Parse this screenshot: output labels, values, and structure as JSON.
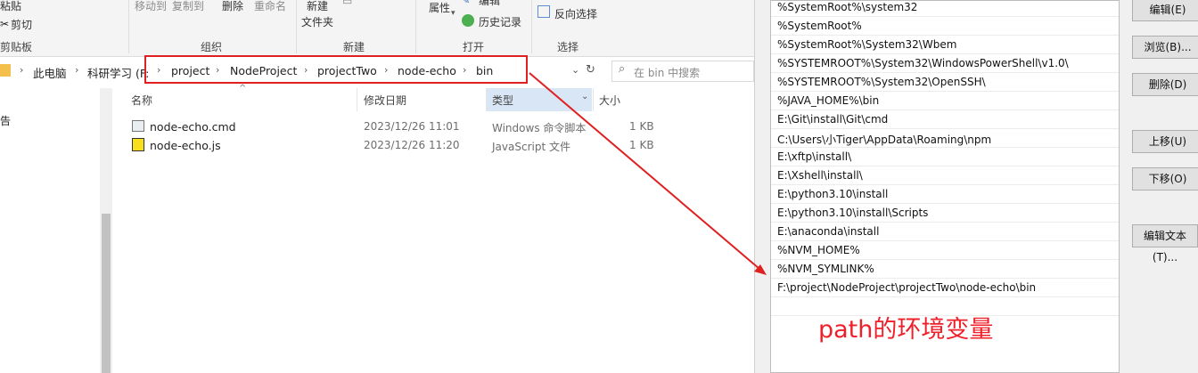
{
  "ribbon": {
    "paste": "粘贴",
    "cut": "剪切",
    "clipboard": "剪贴板",
    "move_to": "移动到",
    "copy_to": "复制到",
    "delete": "删除",
    "rename": "重命名",
    "organize": "组织",
    "new_folder_1": "新建",
    "new_folder_2": "文件夹",
    "new_group": "新建",
    "properties": "属性",
    "edit": "编辑",
    "history": "历史记录",
    "open_group": "打开",
    "invert_select": "反向选择",
    "select_group": "选择"
  },
  "address": {
    "this_pc": "此电脑",
    "drive": "科研学习 (F:",
    "path": [
      "project",
      "NodeProject",
      "projectTwo",
      "node-echo",
      "bin"
    ],
    "search_placeholder": "在 bin 中搜索"
  },
  "file_list": {
    "headers": {
      "name": "名称",
      "modified": "修改日期",
      "type": "类型",
      "size": "大小"
    },
    "files": [
      {
        "name": "node-echo.cmd",
        "modified": "2023/12/26 11:01",
        "type": "Windows 命令脚本",
        "size": "1 KB",
        "icon": "cmd-file-icon"
      },
      {
        "name": "node-echo.js",
        "modified": "2023/12/26 11:20",
        "type": "JavaScript 文件",
        "size": "1 KB",
        "icon": "js-file-icon"
      }
    ],
    "left_pane_partial": "告"
  },
  "env_editor": {
    "paths": [
      "%SystemRoot%\\system32",
      "%SystemRoot%",
      "%SystemRoot%\\System32\\Wbem",
      "%SYSTEMROOT%\\System32\\WindowsPowerShell\\v1.0\\",
      "%SYSTEMROOT%\\System32\\OpenSSH\\",
      "%JAVA_HOME%\\bin",
      "E:\\Git\\install\\Git\\cmd",
      "C:\\Users\\小Tiger\\AppData\\Roaming\\npm",
      "E:\\xftp\\install\\",
      "E:\\Xshell\\install\\",
      "E:\\python3.10\\install",
      "E:\\python3.10\\install\\Scripts",
      "E:\\anaconda\\install",
      "%NVM_HOME%",
      "%NVM_SYMLINK%",
      "F:\\project\\NodeProject\\projectTwo\\node-echo\\bin"
    ],
    "buttons": {
      "edit": "编辑(E)",
      "browse": "浏览(B)...",
      "delete": "删除(D)",
      "move_up": "上移(U)",
      "move_down": "下移(O)",
      "edit_text": "编辑文本(T)..."
    }
  },
  "annotation": {
    "caption": "path的环境变量",
    "color": "#f0202a"
  }
}
